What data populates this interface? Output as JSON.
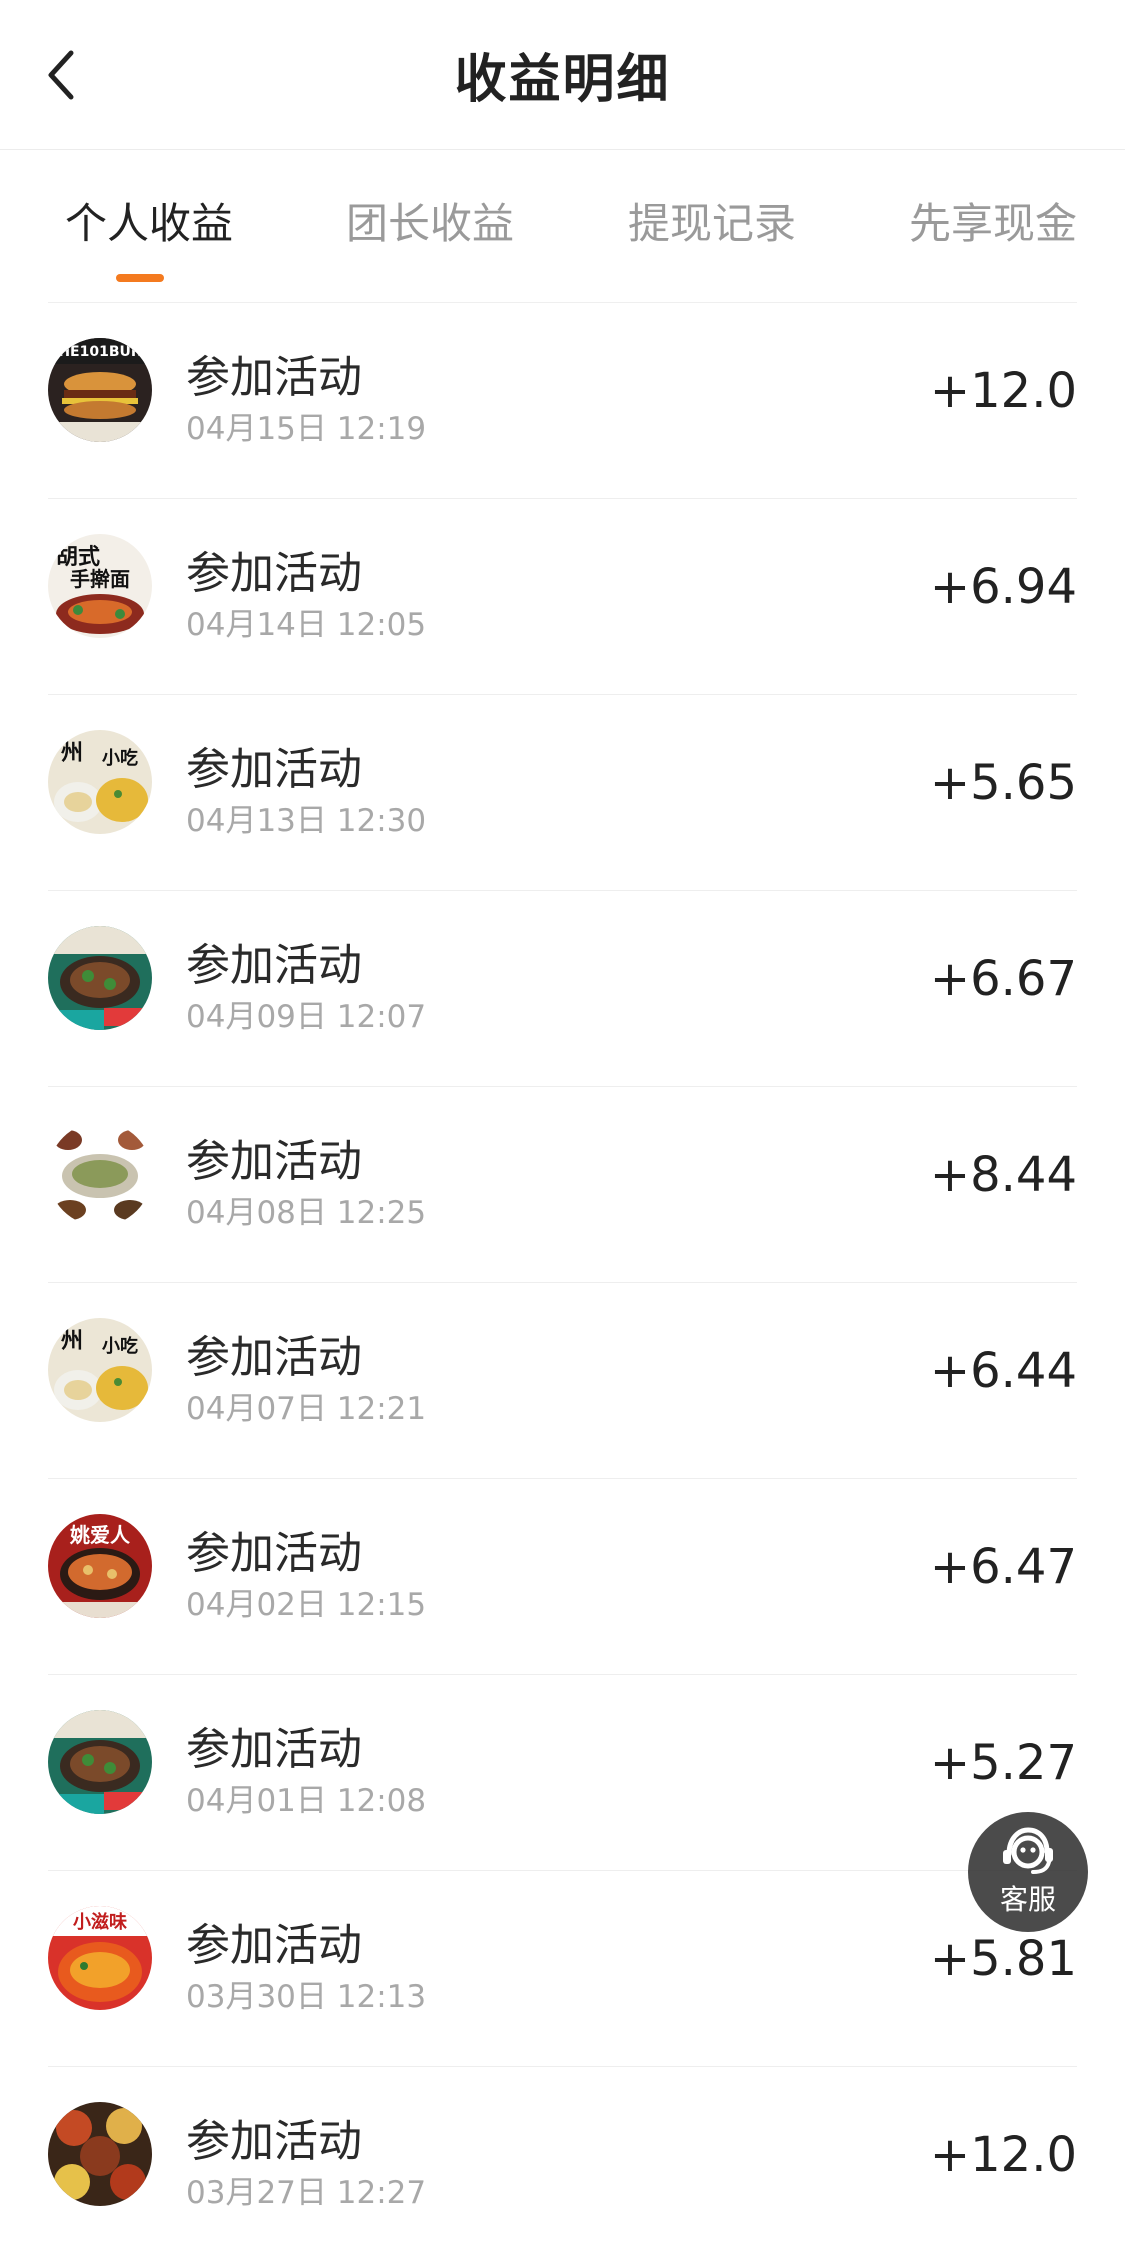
{
  "header": {
    "title": "收益明细"
  },
  "tabs": [
    {
      "label": "个人收益",
      "active": true
    },
    {
      "label": "团长收益",
      "active": false
    },
    {
      "label": "提现记录",
      "active": false
    },
    {
      "label": "先享现金",
      "active": false
    }
  ],
  "colors": {
    "accent": "#f47a1f",
    "text_primary": "#222222",
    "text_secondary": "#a8a8a8"
  },
  "records": [
    {
      "title": "参加活动",
      "time": "04月15日 12:19",
      "amount": "+12.0",
      "thumb_icon": "burger-food-image"
    },
    {
      "title": "参加活动",
      "time": "04月14日 12:05",
      "amount": "+6.94",
      "thumb_icon": "noodle-food-image"
    },
    {
      "title": "参加活动",
      "time": "04月13日 12:30",
      "amount": "+5.65",
      "thumb_icon": "snack-food-image"
    },
    {
      "title": "参加活动",
      "time": "04月09日 12:07",
      "amount": "+6.67",
      "thumb_icon": "claypot-food-image"
    },
    {
      "title": "参加活动",
      "time": "04月08日 12:25",
      "amount": "+8.44",
      "thumb_icon": "soup-food-image"
    },
    {
      "title": "参加活动",
      "time": "04月07日 12:21",
      "amount": "+6.44",
      "thumb_icon": "snack-food-image"
    },
    {
      "title": "参加活动",
      "time": "04月02日 12:15",
      "amount": "+6.47",
      "thumb_icon": "noodle-bowl-food-image"
    },
    {
      "title": "参加活动",
      "time": "04月01日 12:08",
      "amount": "+5.27",
      "thumb_icon": "claypot-food-image"
    },
    {
      "title": "参加活动",
      "time": "03月30日 12:13",
      "amount": "+5.81",
      "thumb_icon": "spicy-food-image"
    },
    {
      "title": "参加活动",
      "time": "03月27日 12:27",
      "amount": "+12.0",
      "thumb_icon": "dishes-food-image"
    }
  ],
  "service": {
    "label": "客服",
    "icon": "customer-service-icon"
  }
}
